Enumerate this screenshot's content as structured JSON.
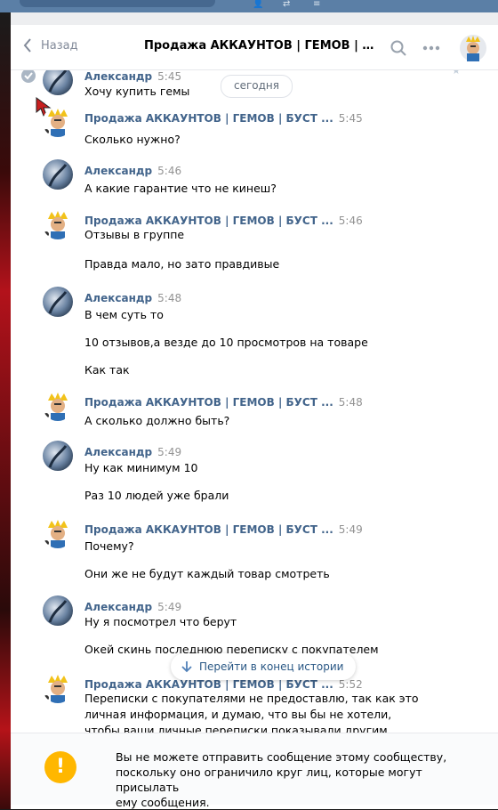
{
  "colors": {
    "accent": "#42648b",
    "link": "#2a5885",
    "warning": "#ffb700",
    "muted": "#828a99"
  },
  "header": {
    "back_label": "Назад",
    "title": "Продажа АККАУНТОВ | ГЕМОВ | БУСТ",
    "icons": [
      "chevron-left-icon",
      "search-icon",
      "more-icon",
      "avatar"
    ]
  },
  "date_separator": "сегодня",
  "scroll_button": "Перейти в конец истории",
  "messages": [
    {
      "author": "Александр",
      "time": "5:45",
      "lines": [
        "Хочу купить гемы"
      ]
    },
    {
      "author": "Продажа АККАУНТОВ | ГЕМОВ | БУСТ ...",
      "time": "5:45",
      "lines": [
        "Сколько нужно?"
      ]
    },
    {
      "author": "Александр",
      "time": "5:46",
      "lines": [
        "А какие гарантие что не кинеш?"
      ]
    },
    {
      "author": "Продажа АККАУНТОВ | ГЕМОВ | БУСТ ...",
      "time": "5:46",
      "lines": [
        "Отзывы в группе",
        "Правда мало, но зато правдивые"
      ]
    },
    {
      "author": "Александр",
      "time": "5:48",
      "lines": [
        "В чем суть то",
        "10 отзывов,а везде до 10 просмотров на товаре",
        "Как так"
      ]
    },
    {
      "author": "Продажа АККАУНТОВ | ГЕМОВ | БУСТ ...",
      "time": "5:48",
      "lines": [
        "А сколько должно быть?"
      ]
    },
    {
      "author": "Александр",
      "time": "5:49",
      "lines": [
        "Ну как минимум 10",
        "Раз 10 людей уже брали"
      ]
    },
    {
      "author": "Продажа АККАУНТОВ | ГЕМОВ | БУСТ ...",
      "time": "5:49",
      "lines": [
        "Почему?",
        "Они же не будут каждый товар смотреть"
      ]
    },
    {
      "author": "Александр",
      "time": "5:49",
      "lines": [
        "Ну я посмотрел что берут",
        "Окей скинь последнюю переписку с покупателем"
      ]
    },
    {
      "author": "Продажа АККАУНТОВ | ГЕМОВ | БУСТ ...",
      "time": "5:52",
      "lines": [
        "Переписки с покупателями не предоставлю, так как это",
        "личная информация, и думаю, что вы бы не хотели,",
        "чтобы ваши личные переписки показывали другим"
      ]
    }
  ],
  "notice": "Вы не можете отправить сообщение этому сообществу,\nпоскольку оно ограничило круг лиц, которые могут присылать\nему сообщения."
}
